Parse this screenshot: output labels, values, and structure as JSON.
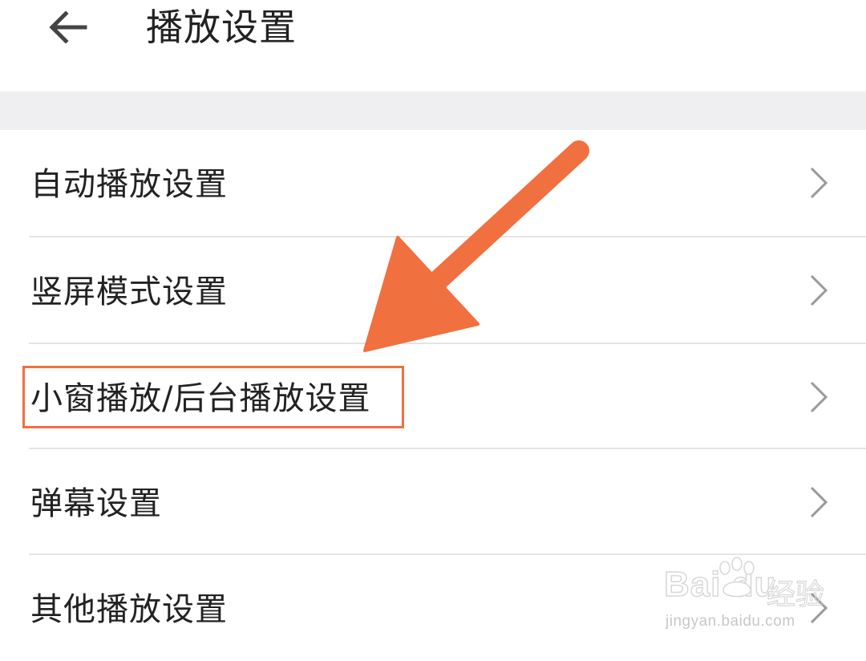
{
  "header": {
    "title": "播放设置",
    "back_icon": "arrow-left-icon"
  },
  "settings": {
    "items": [
      {
        "label": "自动播放设置",
        "icon": "chevron-right-icon"
      },
      {
        "label": "竖屏模式设置",
        "icon": "chevron-right-icon"
      },
      {
        "label": "小窗播放/后台播放设置",
        "icon": "chevron-right-icon",
        "highlighted": true
      },
      {
        "label": "弹幕设置",
        "icon": "chevron-right-icon"
      },
      {
        "label": "其他播放设置",
        "icon": "chevron-right-icon"
      }
    ]
  },
  "annotation": {
    "arrow_color": "#f0703f",
    "box_color": "#f0703f"
  },
  "watermark": {
    "logo": "Bai du",
    "brand": "经验",
    "url": "jingyan.baidu.com"
  },
  "colors": {
    "background": "#ffffff",
    "gap": "#efeff1",
    "text": "#222222",
    "chevron": "#9a9a9a",
    "divider": "#e4e4e4",
    "accent": "#f0703f"
  }
}
